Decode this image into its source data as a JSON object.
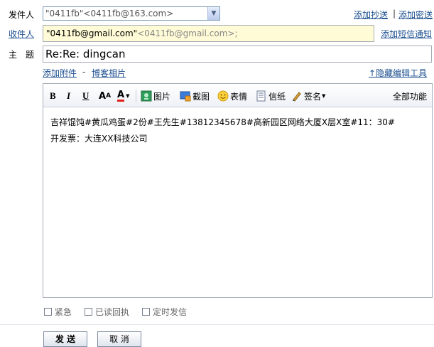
{
  "labels": {
    "from": "发件人",
    "to": "收件人",
    "subject": "主　题"
  },
  "sender": {
    "value": "\"0411fb\"<0411fb@163.com>"
  },
  "links": {
    "add_cc": "添加抄送",
    "add_bcc": "添加密送",
    "add_sms": "添加短信通知",
    "add_attachment": "添加附件",
    "separator": "-",
    "blog_photos": "博客相片",
    "hide_tools": "↑隐藏编辑工具",
    "bar": "|"
  },
  "recipient": {
    "main": "\"0411fb@gmail.com\"",
    "sub": "<0411fb@gmail.com>;"
  },
  "subject": {
    "value": "Re:Re: dingcan"
  },
  "toolbar": {
    "bold": "B",
    "italic": "I",
    "underline": "U",
    "font_size": "A",
    "font_color": "A",
    "image": "图片",
    "screenshot": "截图",
    "emoticon": "表情",
    "stationery": "信纸",
    "signature": "签名",
    "all_functions": "全部功能"
  },
  "body": {
    "line1": "吉祥馄饨#黄瓜鸡蛋#2份#王先生#13812345678#高新园区网络大厦X层X室#11：30#",
    "line2": "开发票：大连XX科技公司"
  },
  "options": {
    "urgent": "紧急",
    "read_receipt": "已读回执",
    "scheduled": "定时发信"
  },
  "buttons": {
    "send": "发 送",
    "cancel": "取 消"
  }
}
